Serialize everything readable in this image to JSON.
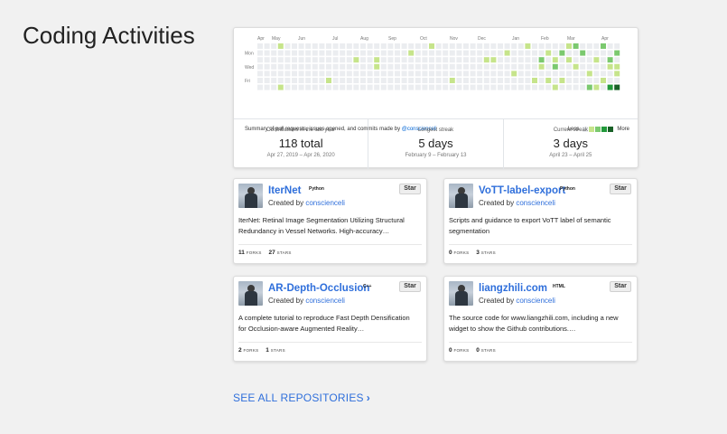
{
  "section": {
    "title": "Coding Activities"
  },
  "contributions": {
    "months": [
      "Apr",
      "May",
      "Jun",
      "Jul",
      "Aug",
      "Sep",
      "Oct",
      "Nov",
      "Dec",
      "Jan",
      "Feb",
      "Mar",
      "Apr"
    ],
    "day_labels": [
      "Mon",
      "Wed",
      "Fri"
    ],
    "summary_prefix": "Summary of pull requests, issues opened, and commits made by ",
    "summary_user": "@conscienceli",
    "legend_less": "Less",
    "legend_more": "More",
    "colors": [
      "#ebedf0",
      "#c6e48b",
      "#7bc96f",
      "#239a3b",
      "#196127"
    ],
    "stats": [
      {
        "label": "Contributions in the last year",
        "value": "118 total",
        "sub": "Apr 27, 2019 – Apr 26, 2020"
      },
      {
        "label": "Longest streak",
        "value": "5 days",
        "sub": "February 9 – February 13"
      },
      {
        "label": "Current streak",
        "value": "3 days",
        "sub": "April 23 – April 25"
      }
    ]
  },
  "repos": [
    {
      "name": "IterNet",
      "language": "Python",
      "created_prefix": "Created by ",
      "author": "conscienceli",
      "star_label": "Star",
      "description": "IterNet: Retinal Image Segmentation Utilizing Structural Redundancy in Vessel Networks. High-accuracy…",
      "forks": "11",
      "forks_label": "FORKS",
      "stars": "27",
      "stars_label": "STARS"
    },
    {
      "name": "VoTT-label-export",
      "language": "Python",
      "created_prefix": "Created by ",
      "author": "conscienceli",
      "star_label": "Star",
      "description": "Scripts and guidance to export VoTT label of semantic segmentation",
      "forks": "0",
      "forks_label": "FORKS",
      "stars": "3",
      "stars_label": "STARS"
    },
    {
      "name": "AR-Depth-Occlusion",
      "language": "C++",
      "created_prefix": "Created by ",
      "author": "conscienceli",
      "star_label": "Star",
      "description": "A complete tutorial to reproduce Fast Depth Densification for Occlusion-aware Augmented Reality…",
      "forks": "2",
      "forks_label": "FORKS",
      "stars": "1",
      "stars_label": "STARS"
    },
    {
      "name": "liangzhili.com",
      "language": "HTML",
      "created_prefix": "Created by ",
      "author": "conscienceli",
      "star_label": "Star",
      "description": "The source code for www.liangzhili.com, including a new widget to show the Github contributions.…",
      "forks": "0",
      "forks_label": "FORKS",
      "stars": "0",
      "stars_label": "STARS"
    }
  ],
  "footer": {
    "see_all_label": "SEE ALL REPOSITORIES",
    "chevron": "›"
  }
}
